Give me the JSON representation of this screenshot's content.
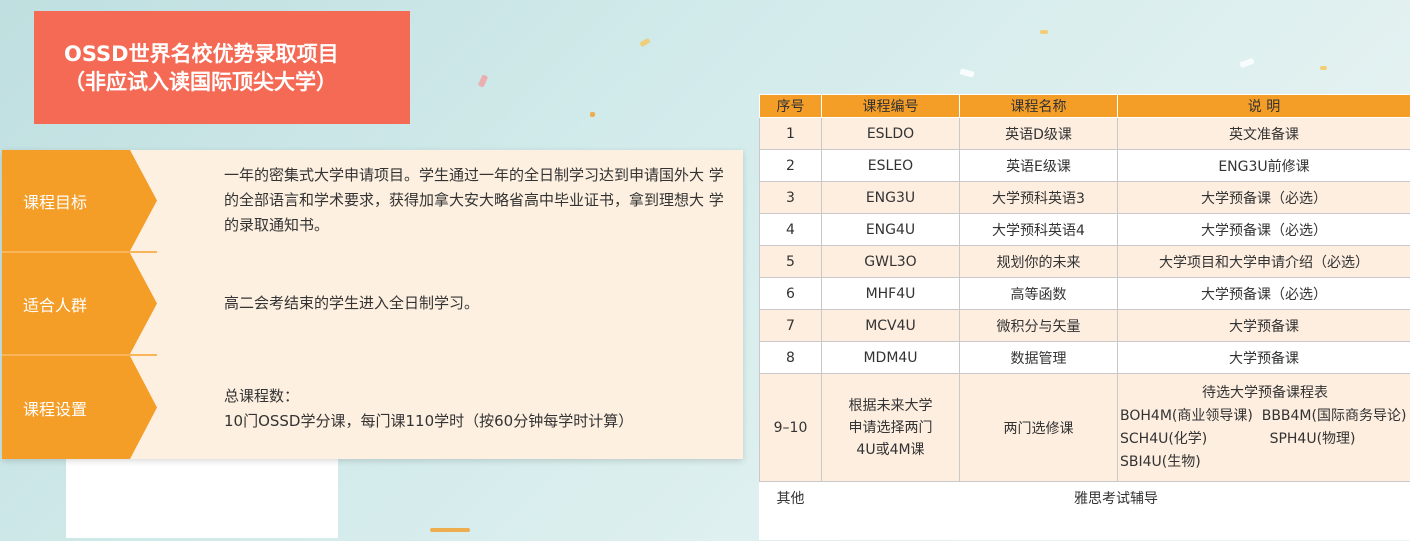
{
  "banner": {
    "line1": "OSSD世界名校优势录取项目",
    "line2": "（非应试入读国际顶尖大学）"
  },
  "info": {
    "goal": {
      "label": "课程目标",
      "text": "一年的密集式大学申请项目。学生通过一年的全日制学习达到申请国外大 学的全部语言和学术要求，获得加拿大安大略省高中毕业证书，拿到理想大 学的录取通知书。"
    },
    "audience": {
      "label": "适合人群",
      "text": "高二会考结束的学生进入全日制学习。"
    },
    "setup": {
      "label": "课程设置",
      "line1": "总课程数：",
      "line2": "10门OSSD学分课，每门课110学时（按60分钟每学时计算）"
    }
  },
  "table": {
    "headers": [
      "序号",
      "课程编号",
      "课程名称",
      "说 明"
    ],
    "rows": [
      [
        "1",
        "ESLDO",
        "英语D级课",
        "英文准备课"
      ],
      [
        "2",
        "ESLEO",
        "英语E级课",
        "ENG3U前修课"
      ],
      [
        "3",
        "ENG3U",
        "大学预科英语3",
        "大学预备课（必选）"
      ],
      [
        "4",
        "ENG4U",
        "大学预科英语4",
        "大学预备课（必选）"
      ],
      [
        "5",
        "GWL3O",
        "规划你的未来",
        "大学项目和大学申请介绍（必选）"
      ],
      [
        "6",
        "MHF4U",
        "高等函数",
        "大学预备课（必选）"
      ],
      [
        "7",
        "MCV4U",
        "微积分与矢量",
        "大学预备课"
      ],
      [
        "8",
        "MDM4U",
        "数据管理",
        "大学预备课"
      ]
    ],
    "elective": {
      "num": "9–10",
      "code_line1": "根据未来大学",
      "code_line2": "申请选择两门",
      "code_line3": "4U或4M课",
      "name": "两门选修课",
      "title": "待选大学预备课程表",
      "line1": "BOH4M(商业领导课)  BBB4M(国际商务导论)",
      "line2": "SCH4U(化学)              SPH4U(物理)",
      "line3": "SBI4U(生物)"
    },
    "other": {
      "label": "其他",
      "value": "雅思考试辅导"
    }
  },
  "colors": {
    "banner": "#f56a55",
    "orange": "#f49d27",
    "panel_bg": "#fdf0e0",
    "row_tint": "#fdeee0"
  }
}
